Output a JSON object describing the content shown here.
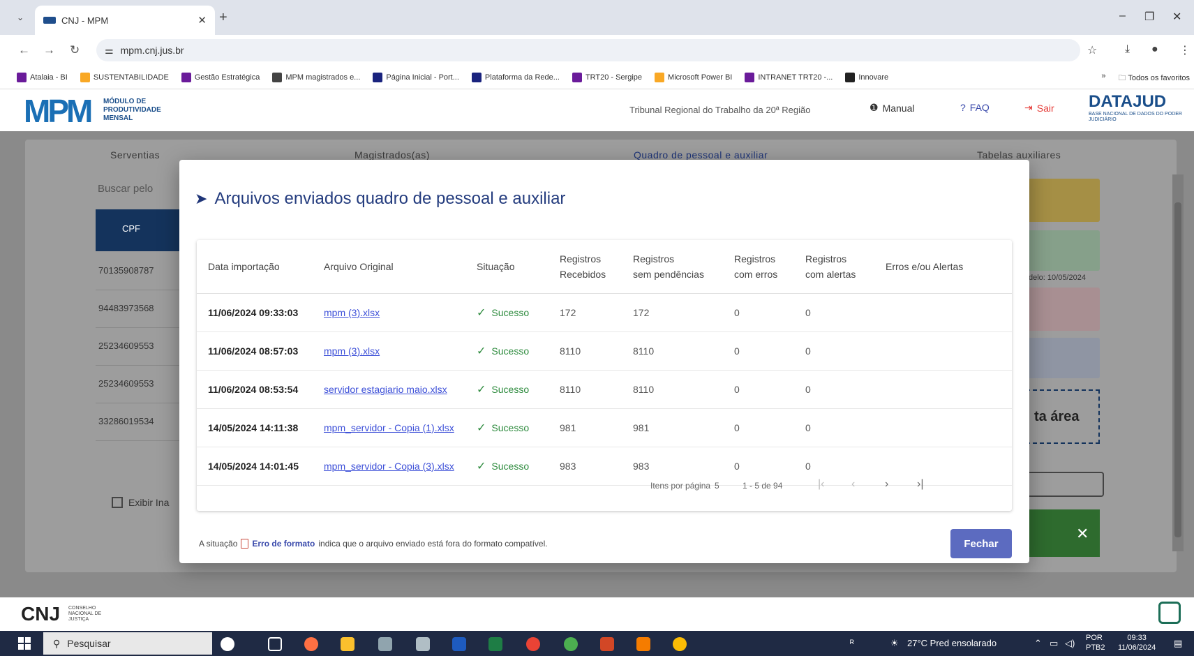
{
  "browser": {
    "tab_title": "CNJ - MPM",
    "url": "mpm.cnj.jus.br",
    "bookmarks": [
      {
        "label": "Atalaia - BI",
        "color": "#6a1b9a"
      },
      {
        "label": "SUSTENTABILIDADE",
        "color": "#f9a825"
      },
      {
        "label": "Gestão Estratégica",
        "color": "#6a1b9a"
      },
      {
        "label": "MPM magistrados e...",
        "color": "#444444"
      },
      {
        "label": "Página Inicial - Port...",
        "color": "#1a237e"
      },
      {
        "label": "Plataforma da Rede...",
        "color": "#1a237e"
      },
      {
        "label": "TRT20 - Sergipe",
        "color": "#6a1b9a"
      },
      {
        "label": "Microsoft Power BI",
        "color": "#f9a825"
      },
      {
        "label": "INTRANET TRT20 -...",
        "color": "#6a1b9a"
      },
      {
        "label": "Innovare",
        "color": "#222222"
      }
    ],
    "bookmarks_more": "»",
    "all_bookmarks": "Todos os favoritos"
  },
  "header": {
    "logo": "MPM",
    "logo_sub": "MÓDULO DE PRODUTIVIDADE MENSAL",
    "tribunal": "Tribunal Regional do Trabalho da 20ª Região",
    "manual": "Manual",
    "faq": "FAQ",
    "sair": "Sair",
    "datajud": "DATAJUD",
    "datajud_sub": "BASE NACIONAL DE DADOS DO PODER JUDICIÁRIO"
  },
  "background": {
    "nav": [
      "Serventias",
      "Magistrados(as)",
      "Quadro de pessoal e auxiliar",
      "Tabelas auxiliares"
    ],
    "search": "Buscar pelo",
    "cpf_header": "CPF",
    "cpfs": [
      "70135908787",
      "94483973568",
      "25234609553",
      "25234609553",
      "33286019534"
    ],
    "exibir": "Exibir Ina",
    "modelo": "delo: 10/05/2024",
    "area": "ta área"
  },
  "modal": {
    "title": "Arquivos enviados quadro de pessoal e auxiliar",
    "columns": {
      "data": "Data importação",
      "arquivo": "Arquivo Original",
      "situacao": "Situação",
      "recebidos_1": "Registros",
      "recebidos_2": "Recebidos",
      "sem_pend_1": "Registros",
      "sem_pend_2": "sem pendências",
      "erros_1": "Registros",
      "erros_2": "com erros",
      "alertas_1": "Registros",
      "alertas_2": "com alertas",
      "erros_alertas": "Erros e/ou Alertas"
    },
    "rows": [
      {
        "data": "11/06/2024 09:33:03",
        "arquivo": "mpm (3).xlsx",
        "situacao": "Sucesso",
        "recebidos": "172",
        "sem_pend": "172",
        "erros": "0",
        "alertas": "0"
      },
      {
        "data": "11/06/2024 08:57:03",
        "arquivo": "mpm (3).xlsx",
        "situacao": "Sucesso",
        "recebidos": "8110",
        "sem_pend": "8110",
        "erros": "0",
        "alertas": "0"
      },
      {
        "data": "11/06/2024 08:53:54",
        "arquivo": "servidor estagiario maio.xlsx",
        "situacao": "Sucesso",
        "recebidos": "8110",
        "sem_pend": "8110",
        "erros": "0",
        "alertas": "0"
      },
      {
        "data": "14/05/2024 14:11:38",
        "arquivo": "mpm_servidor - Copia (1).xlsx",
        "situacao": "Sucesso",
        "recebidos": "981",
        "sem_pend": "981",
        "erros": "0",
        "alertas": "0"
      },
      {
        "data": "14/05/2024 14:01:45",
        "arquivo": "mpm_servidor - Copia (3).xlsx",
        "situacao": "Sucesso",
        "recebidos": "983",
        "sem_pend": "983",
        "erros": "0",
        "alertas": "0"
      }
    ],
    "pager": {
      "items_label": "Itens por página",
      "items_value": "5",
      "range": "1 - 5 de 94"
    },
    "footer_pre": "A situação",
    "footer_erro": "Erro de formato",
    "footer_post": "indica que o arquivo enviado está fora do formato compatível.",
    "close": "Fechar"
  },
  "footer": {
    "cnj": "CNJ",
    "cnj_sub": "CONSELHO NACIONAL DE JUSTIÇA"
  },
  "taskbar": {
    "search": "Pesquisar",
    "weather": "27°C Pred ensolarado",
    "lang_1": "POR",
    "lang_2": "PTB2",
    "time": "09:33",
    "date": "11/06/2024"
  }
}
